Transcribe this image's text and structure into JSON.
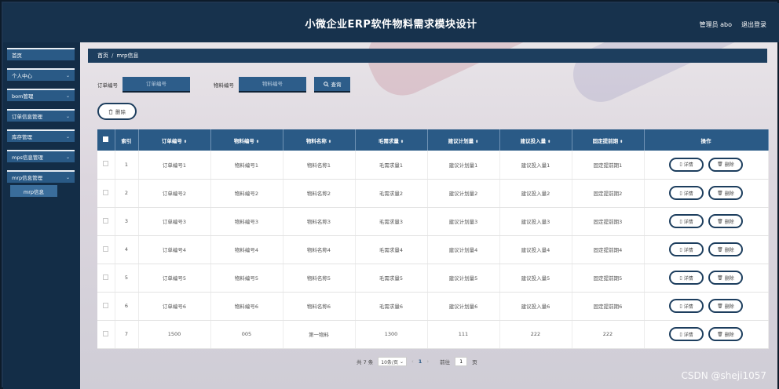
{
  "header": {
    "title": "小微企业ERP软件物料需求模块设计",
    "user_label": "管理员 abo",
    "logout_label": "退出登录"
  },
  "sidebar": {
    "items": [
      {
        "label": "首页",
        "chevron": ""
      },
      {
        "label": "个人中心",
        "chevron": "⌄"
      },
      {
        "label": "bom管理",
        "chevron": "⌄"
      },
      {
        "label": "订单信息管理",
        "chevron": "⌄"
      },
      {
        "label": "库存管理",
        "chevron": "⌄"
      },
      {
        "label": "mps信息管理",
        "chevron": "⌄"
      },
      {
        "label": "mrp信息管理",
        "chevron": "⌄"
      }
    ],
    "submenu": {
      "label": "mrp信息"
    }
  },
  "breadcrumb": {
    "home": "首页",
    "separator": "/",
    "current": "mrp信息"
  },
  "search": {
    "order_label": "订单编号",
    "order_placeholder": "订单编号",
    "material_label": "物料编号",
    "material_placeholder": "物料编号",
    "button_label": "查询"
  },
  "actions": {
    "batch_delete": "删除"
  },
  "table": {
    "columns": [
      "索引",
      "订单编号",
      "物料编号",
      "物料名称",
      "毛需求量",
      "建议计划量",
      "建议投入量",
      "固定提前期",
      "操作"
    ],
    "sortable": [
      false,
      true,
      true,
      true,
      true,
      true,
      true,
      true,
      false
    ],
    "rows": [
      [
        "1",
        "订单编号1",
        "物料编号1",
        "物料名称1",
        "毛需求量1",
        "建议计划量1",
        "建议投入量1",
        "固定提前期1"
      ],
      [
        "2",
        "订单编号2",
        "物料编号2",
        "物料名称2",
        "毛需求量2",
        "建议计划量2",
        "建议投入量2",
        "固定提前期2"
      ],
      [
        "3",
        "订单编号3",
        "物料编号3",
        "物料名称3",
        "毛需求量3",
        "建议计划量3",
        "建议投入量3",
        "固定提前期3"
      ],
      [
        "4",
        "订单编号4",
        "物料编号4",
        "物料名称4",
        "毛需求量4",
        "建议计划量4",
        "建议投入量4",
        "固定提前期4"
      ],
      [
        "5",
        "订单编号5",
        "物料编号5",
        "物料名称5",
        "毛需求量5",
        "建议计划量5",
        "建议投入量5",
        "固定提前期5"
      ],
      [
        "6",
        "订单编号6",
        "物料编号6",
        "物料名称6",
        "毛需求量6",
        "建议计划量6",
        "建议投入量6",
        "固定提前期6"
      ],
      [
        "7",
        "1500",
        "005",
        "第一物料",
        "1300",
        "111",
        "222",
        "222"
      ]
    ],
    "detail_label": "详情",
    "delete_label": "删除"
  },
  "pagination": {
    "total": "共 7 条",
    "page_size": "10条/页",
    "current_page": "1",
    "goto_label": "前往",
    "goto_value": "1",
    "page_suffix": "页"
  },
  "watermark": "CSDN @sheji1057",
  "colors": {
    "header_bg": "#17324d",
    "accent": "#2a5a86",
    "button_border": "#1d3e5e"
  }
}
